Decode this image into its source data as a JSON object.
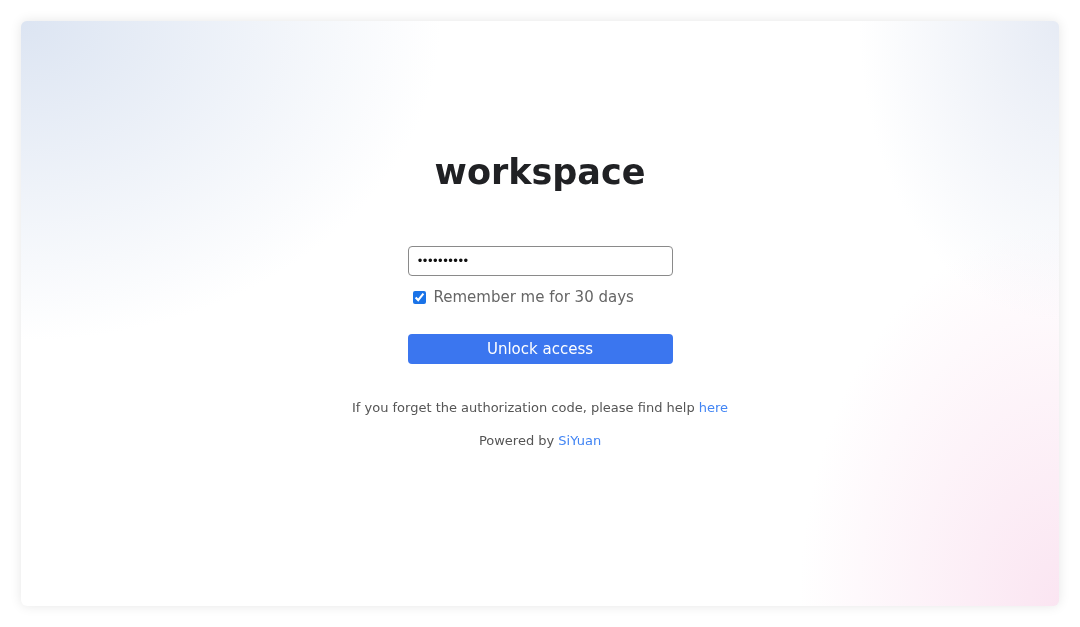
{
  "title": "workspace",
  "password_field": {
    "value": "••••••••••"
  },
  "remember": {
    "label": "Remember me for 30 days",
    "checked": true
  },
  "unlock_button": {
    "label": "Unlock access"
  },
  "help": {
    "text": "If you forget the authorization code, please find help",
    "link": "here"
  },
  "footer": {
    "text": "Powered by",
    "link": "SiYuan"
  }
}
